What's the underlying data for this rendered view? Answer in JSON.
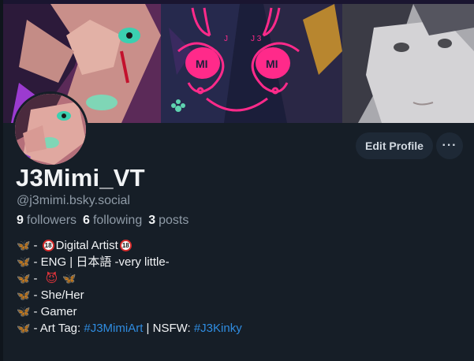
{
  "profile": {
    "display_name": "J3Mimi_VT",
    "handle": "@j3mimi.bsky.social",
    "stats": {
      "followers_count": "9",
      "followers_label": "followers",
      "following_count": "6",
      "following_label": "following",
      "posts_count": "3",
      "posts_label": "posts"
    }
  },
  "actions": {
    "edit_profile": "Edit Profile",
    "more": "···"
  },
  "bio": {
    "line1_pre": "- ",
    "line1_badge": "18",
    "line1_text": "Digital Artist",
    "line2_text": "- ENG | 日本語 -very little-",
    "line3_prefix": "- ",
    "line4_text": "- She/Her",
    "line5_text": "- Gamer",
    "line6_prefix": "- Art Tag: ",
    "line6_tag1": "#J3MimiArt",
    "line6_mid": " | NSFW: ",
    "line6_tag2": "#J3Kinky"
  },
  "banner_text": {
    "mi_left": "MI",
    "mi_right": "MI",
    "j3_left": "J",
    "j3_right": "J 3"
  },
  "colors": {
    "background": "#161e27",
    "accent_link": "#2f8ce0",
    "button_bg": "#1e2936",
    "muted_text": "#8f9ba7"
  },
  "icons": {
    "bullet": "butterfly-icon",
    "age": "adults-only-18-icon",
    "devil": "smiling-devil-icon",
    "more": "ellipsis-icon"
  }
}
